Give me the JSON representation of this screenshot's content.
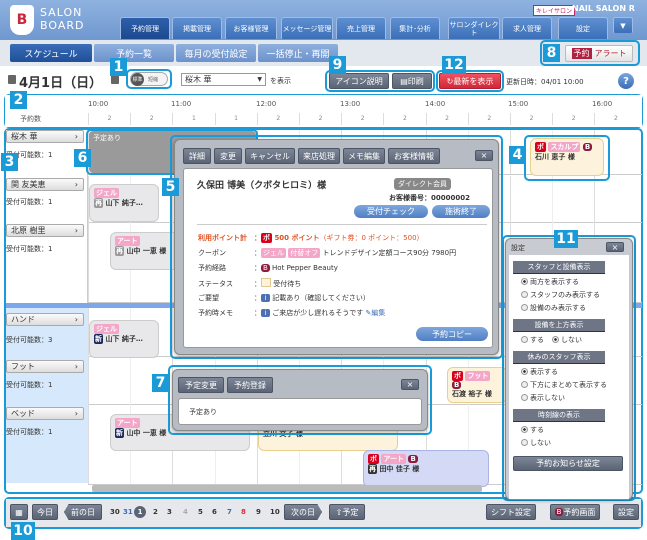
{
  "header": {
    "logo_text_1": "SALON",
    "logo_text_2": "BOARD",
    "salon_badge": "キレイサロン",
    "salon_name": "NAIL SALON R",
    "tabs": [
      "予約管理",
      "掲載管理",
      "お客様管理",
      "メッセージ管理",
      "売上管理",
      "集計･分析",
      "サロンダイレクト",
      "求人管理",
      "設定"
    ]
  },
  "subnav": {
    "items": [
      "スケジュール",
      "予約一覧",
      "毎月の受付設定",
      "一括停止・再開"
    ],
    "alert_badge": "予約",
    "alert_label": "アラート"
  },
  "toolbar": {
    "date": "4月1日（日）",
    "toggle_on": "標準",
    "toggle_off": "短縮",
    "staff_select": "桜木 華",
    "show_label": "を表示",
    "icon_help": "アイコン説明",
    "print": "印刷",
    "refresh": "最新を表示",
    "updated": "更新日時：04/01 10:00",
    "help": "?"
  },
  "timeline": {
    "times": [
      "10:00",
      "11:00",
      "12:00",
      "13:00",
      "14:00",
      "15:00",
      "16:00"
    ],
    "count_label": "予約数",
    "counts": [
      "2",
      "2",
      "1",
      "1",
      "2",
      "2",
      "2",
      "2",
      "2",
      "2",
      "2",
      "2",
      "2"
    ]
  },
  "staff": [
    {
      "name": "桜木 華",
      "cap": "受付可能数：1"
    },
    {
      "name": "関 友美恵",
      "cap": "受付可能数：1"
    },
    {
      "name": "北原 樹里",
      "cap": "受付可能数：1"
    }
  ],
  "equipment": [
    {
      "name": "ハンド",
      "cap": "受付可能数：3"
    },
    {
      "name": "フット",
      "cap": "受付可能数：1"
    },
    {
      "name": "ベッド",
      "cap": "受付可能数：1"
    }
  ],
  "events": {
    "block": "予定あり",
    "e1": {
      "tag": "ジェル",
      "name": "山下 純子…"
    },
    "e2": {
      "tag": "アート",
      "name": "山中 一恵 様"
    },
    "e3": {
      "po": "ポ",
      "tag": "スカルプ",
      "hb": "B",
      "name": "石川 恵子 様"
    },
    "e4": {
      "tag": "ジェル",
      "name": "山下 純子…"
    },
    "e5": {
      "po": "ポ",
      "tag": "フット",
      "hb": "B",
      "name": "石渡 裕子 様"
    },
    "e6": {
      "tag": "アート",
      "name": "山中 一恵 様"
    },
    "e7": {
      "name": "立川 文子 様"
    },
    "e8": {
      "po": "ポ",
      "tag": "アート",
      "hb": "B",
      "name": "田中 佳子 様"
    },
    "new_mark": "新",
    "return_mark": "再"
  },
  "detail_popup": {
    "buttons": [
      "詳細",
      "変更",
      "キャンセル",
      "来店処理",
      "メモ編集",
      "お客様情報"
    ],
    "close": "×",
    "customer": "久保田 博美（クボタヒロミ）様",
    "member": "ダイレクト会員",
    "customer_no": "お客様番号：00000002",
    "check_in": "受付チェック",
    "done": "施術終了",
    "points_label": "利用ポイント計",
    "points_value": "500 ポイント",
    "points_detail": "（ギフト券：0 ポイント：500）",
    "coupon_label": "クーポン",
    "coupon_tags": [
      "ジェル",
      "付替オフ"
    ],
    "coupon_text": "トレンドデザイン定額コース90分 7980円",
    "route_label": "予約経路",
    "route_value": "Hot Pepper Beauty",
    "status_label": "ステータス",
    "status_value": "受付待ち",
    "request_label": "ご要望",
    "request_value": "記載あり（確認してください）",
    "memo_label": "予約時メモ",
    "memo_value": "ご来店が少し遅れるそうです",
    "edit": "編集",
    "copy": "予約コピー"
  },
  "block_popup": {
    "buttons": [
      "予定変更",
      "予約登録"
    ],
    "close": "×",
    "text": "予定あり"
  },
  "settings": {
    "title": "設定",
    "close": "×",
    "sections": [
      {
        "title": "スタッフと設備表示",
        "options": [
          "両方を表示する",
          "スタッフのみ表示する",
          "設備のみ表示する"
        ],
        "selected": 0
      },
      {
        "title": "設備を上方表示",
        "options": [
          "する",
          "しない"
        ],
        "selected": 1,
        "inline": true
      },
      {
        "title": "休みのスタッフ表示",
        "options": [
          "表示する",
          "下方にまとめて表示する",
          "表示しない"
        ],
        "selected": 0
      },
      {
        "title": "時刻線の表示",
        "options": [
          "する",
          "しない"
        ],
        "selected": 0
      }
    ],
    "notify": "予約お知らせ設定"
  },
  "footer": {
    "calendar": "カレンダー",
    "today": "今日",
    "prev": "前の日",
    "days": [
      "30",
      "31",
      "1",
      "2",
      "3",
      "4",
      "5",
      "6",
      "7",
      "8",
      "9",
      "10"
    ],
    "current_day": "1",
    "next": "次の日",
    "plan": "予定",
    "shift": "シフト設定",
    "booking_screen": "予約画面",
    "settings": "設定"
  },
  "callouts": [
    "1",
    "2",
    "3",
    "4",
    "5",
    "6",
    "7",
    "8",
    "9",
    "10",
    "11",
    "12"
  ],
  "colors": {
    "accent": "#1a9ad6",
    "header": "#7aa3d8",
    "active_tab": "#1f4f98",
    "refresh": "#e03040",
    "point": "#d8001c",
    "coupon": "#f4a6c8"
  }
}
